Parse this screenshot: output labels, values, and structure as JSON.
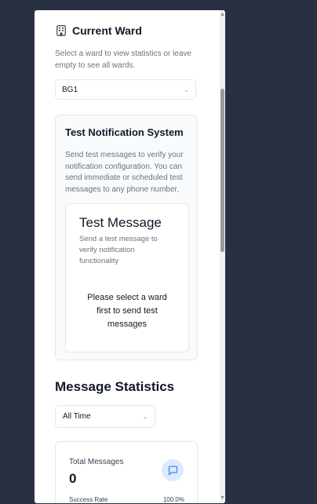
{
  "ward": {
    "title": "Current Ward",
    "description": "Select a ward to view statistics or leave empty to see all wards.",
    "selected": "BG1",
    "icon": "building-icon"
  },
  "test_notification": {
    "title": "Test Notification System",
    "description": "Send test messages to verify your notification configuration. You can send immediate or scheduled test messages to any phone number.",
    "test_message": {
      "title": "Test Message",
      "description": "Send a test message to verify notification functionality",
      "note": "Please select a ward first to send test messages"
    }
  },
  "message_statistics": {
    "title": "Message Statistics",
    "time_range": "All Time",
    "total_messages_label": "Total Messages",
    "total_messages_value": "0",
    "success_rate_label": "Success Rate",
    "success_rate_value": "100.0%",
    "icon": "message-square-icon"
  },
  "colors": {
    "background": "#283042",
    "panel": "#ffffff",
    "accent_blue": "#3b82f6",
    "icon_bg": "#dbeafe"
  }
}
